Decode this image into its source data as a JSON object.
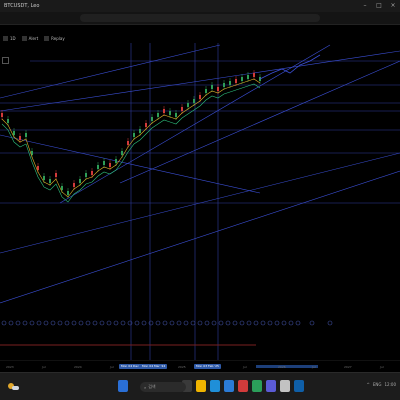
{
  "titlebar": {
    "tab_label": "BTCUSDT, Leo",
    "minimize": "–",
    "maximize": "□",
    "close": "×"
  },
  "toolbar": {
    "interval": "1D",
    "indicators_label": "Alert",
    "replay_label": "Replay"
  },
  "time_axis": {
    "ticks": [
      "2023",
      "Jul",
      "2024",
      "Jul",
      "2025",
      "Jul",
      "2026",
      "Jul",
      "2027",
      "Jul"
    ],
    "markers": [
      "Mon 04 Dec '23",
      "Mon 04 Mar '24",
      "Mon 03 Feb '25"
    ]
  },
  "taskbar": {
    "search_label": "검색",
    "tray": [
      "^",
      "ENG",
      "12:00",
      "2025-03-01"
    ]
  },
  "colors": {
    "background": "#000000",
    "grid_line": "#2f3d9e",
    "trend_line": "#3b4fd6",
    "candle_up": "#2e9d57",
    "candle_down": "#d23a3a",
    "ma_fast": "#e0b429",
    "ma_slow": "#2ec27e",
    "event_icon": "#3f4fa0"
  }
}
